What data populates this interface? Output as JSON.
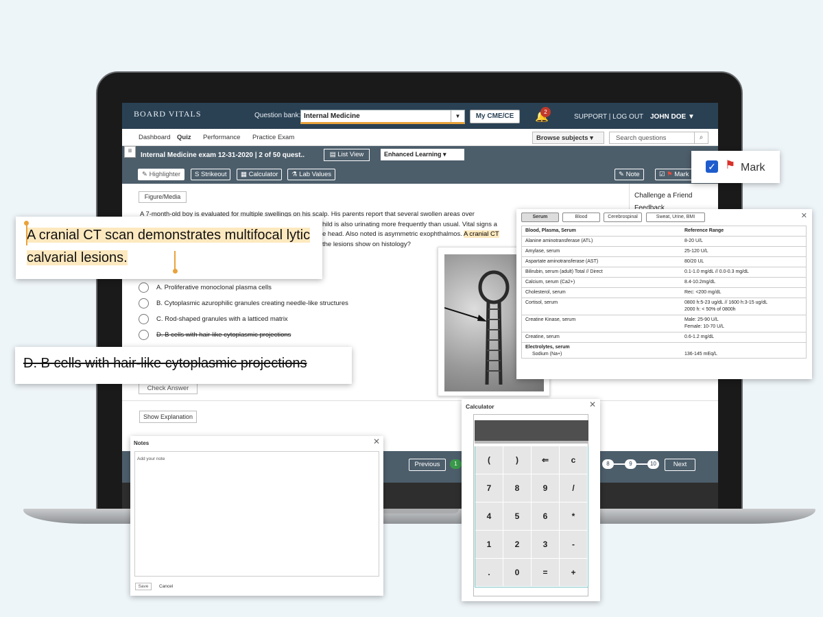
{
  "app": {
    "logo": "BOARD VITALS"
  },
  "topbar": {
    "qb_label": "Question bank:",
    "qb_value": "Internal Medicine",
    "cme_button": "My CME/CE",
    "notification_count": "2",
    "support": "SUPPORT",
    "logout": "LOG OUT",
    "username": "JOHN DOE"
  },
  "nav": {
    "items": [
      "Dashboard",
      "Quiz",
      "Performance",
      "Practice Exam"
    ],
    "browse_subjects": "Browse subjects",
    "search_placeholder": "Search questions"
  },
  "exam": {
    "title": "Internal Medicine exam  12-31-2020 | 2 of 50 quest..",
    "list_view": "List View",
    "mode": "Enhanced Learning"
  },
  "toolbar": {
    "highlighter": "Highlighter",
    "strikeout": "Strikeout",
    "calculator": "Calculator",
    "lab_values": "Lab Values",
    "note": "Note",
    "mark": "Mark"
  },
  "question": {
    "figure_button": "Figure/Media",
    "stem_line1": "A 7-month-old boy is evaluated for multiple swellings on his scalp. His parents report that several swollen areas over",
    "stem_line2": "hild is also urinating more frequently than usual. Vital signs a",
    "stem_line3a": "e head. Also noted is asymmetric exophthalmos.",
    "stem_line3b": "A cranial CT",
    "stem_line4": "the lesions show on histology?",
    "choices": [
      "A.  Proliferative monoclonal plasma cells",
      "B.  Cytoplasmic azurophilic granules creating needle-like structures",
      "C. Rod-shaped granules with a latticed matrix",
      "D. B cells with hair-like cytoplasmic projections"
    ],
    "check_answer": "Check Answer",
    "show_explanation": "Show Explanation"
  },
  "sidebar": {
    "challenge": "Challenge a Friend",
    "feedback": "Feedback"
  },
  "footer": {
    "previous": "Previous",
    "next": "Next",
    "pages_left": [
      "1"
    ],
    "pages_right": [
      "8",
      "9",
      "10"
    ]
  },
  "highlight_popup": {
    "text": "A cranial CT scan demonstrates multifocal lytic calvarial lesions."
  },
  "strike_popup": {
    "text": "D. B cells with hair-like cytoplasmic projections"
  },
  "mark_popup": {
    "label": "Mark"
  },
  "lab_values": {
    "tabs": [
      "Serum",
      "Blood",
      "Cerebrospinal",
      "Sweat, Urine, BMI"
    ],
    "header": [
      "Blood, Plasma, Serum",
      "Reference Range"
    ],
    "rows": [
      [
        "Alanine aminotransferase (ATL)",
        "8-20 U/L"
      ],
      [
        "Amylase, serum",
        "25-120 U/L"
      ],
      [
        "Aspartate aminotransferase (AST)",
        "80/20 UL"
      ],
      [
        "Bilirubin, serum (adult) Total // Direct",
        "0.1-1.0 mg/dL // 0.0-0.3 mg/dL"
      ],
      [
        "Calcium, serum (Ca2+)",
        "8.4-10.2mg/dL"
      ],
      [
        "Cholesterol, serum",
        "Rec: <200 mg/dL"
      ],
      [
        "Cortisol, serum",
        "0800 h:5-23 ug/dL // 1600 h:3-15 ug/dL\n2000 h: < 50% of 0800h"
      ],
      [
        "Creatine Kinase, serum",
        "Male: 25-90 U/L\nFemale: 10-70 U/L"
      ],
      [
        "Creatine, serum",
        "0.6-1.2 mg/dL"
      ]
    ],
    "electrolytes_label": "Electrolytes, serum",
    "sodium_label": "Sodium (Na+)",
    "sodium_range": "136-145 mEq/L"
  },
  "notes": {
    "title": "Notes",
    "placeholder": "Add your note",
    "save": "Save",
    "cancel": "Cancel"
  },
  "calculator": {
    "title": "Calculator",
    "keys": [
      "(",
      ")",
      "⇐",
      "c",
      "7",
      "8",
      "9",
      "/",
      "4",
      "5",
      "6",
      "*",
      "1",
      "2",
      "3",
      "-",
      ".",
      "0",
      "=",
      "+"
    ]
  }
}
